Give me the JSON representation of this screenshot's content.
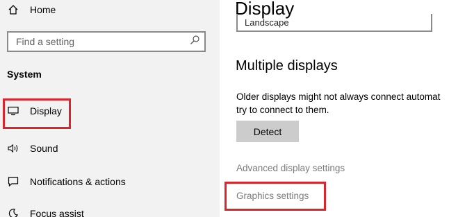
{
  "sidebar": {
    "home_label": "Home",
    "search_placeholder": "Find a setting",
    "section_title": "System",
    "items": [
      {
        "label": "Display",
        "icon": "monitor-icon"
      },
      {
        "label": "Sound",
        "icon": "speaker-icon"
      },
      {
        "label": "Notifications & actions",
        "icon": "notification-icon"
      },
      {
        "label": "Focus assist",
        "icon": "moon-icon"
      }
    ]
  },
  "main": {
    "title": "Display",
    "orientation_value": "Landscape",
    "multiple_displays_heading": "Multiple displays",
    "description_line1": "Older displays might not always connect automat",
    "description_line2": "try to connect to them.",
    "detect_button": "Detect",
    "advanced_link": "Advanced display settings",
    "graphics_link": "Graphics settings"
  },
  "colors": {
    "highlight": "#d9262c",
    "sidebar_bg": "#f2f2f2",
    "button_bg": "#cccccc",
    "link_gray": "#7a7a7a"
  }
}
